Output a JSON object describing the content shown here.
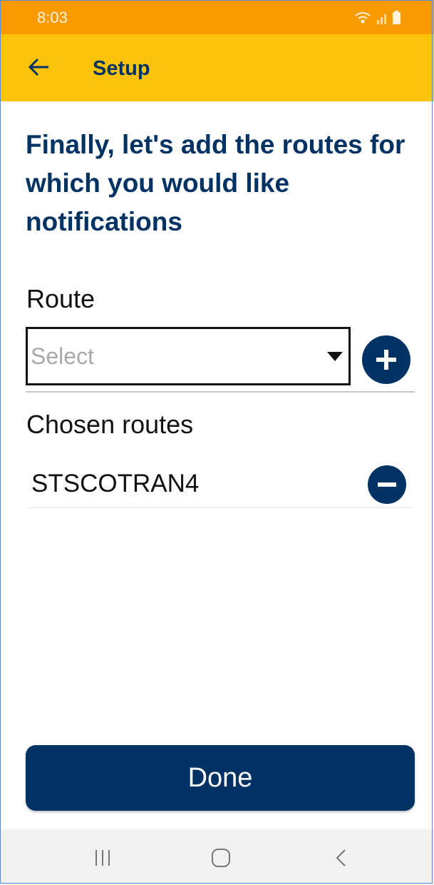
{
  "status_bar": {
    "time": "8:03",
    "icons": [
      "wifi-icon",
      "signal-icon",
      "battery-icon"
    ],
    "color": "#f99a00"
  },
  "app_bar": {
    "title": "Setup",
    "back_icon": "back-arrow-icon",
    "color": "#fdc20a"
  },
  "main": {
    "heading": "Finally, let's add the routes for which you would like notifications",
    "route_label": "Route",
    "route_select": {
      "placeholder": "Select",
      "value": ""
    },
    "add_icon": "plus-circle-icon",
    "chosen_label": "Chosen routes",
    "chosen_routes": [
      {
        "name": "STSCOTRAN4",
        "remove_icon": "minus-circle-icon"
      }
    ]
  },
  "done_button": {
    "label": "Done",
    "color": "#003364"
  },
  "nav_bar": {
    "buttons": [
      "recent-apps-icon",
      "home-icon",
      "back-icon"
    ]
  },
  "colors": {
    "primary": "#003364",
    "accent": "#fdc20a",
    "status": "#f99a00"
  }
}
